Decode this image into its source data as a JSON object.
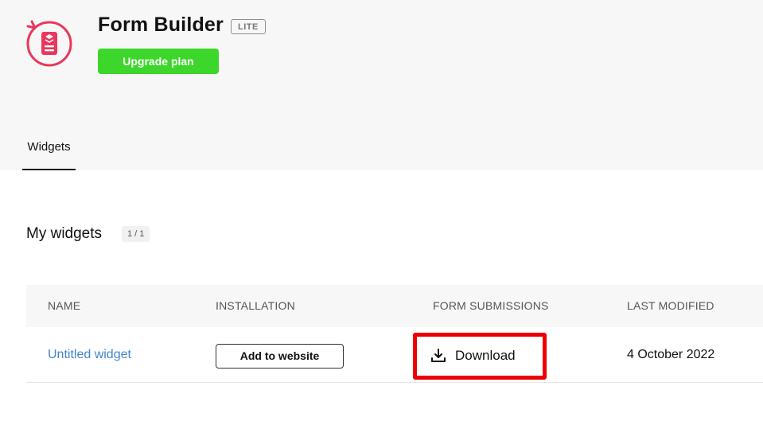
{
  "app": {
    "title": "Form Builder",
    "plan_badge": "LITE",
    "upgrade_label": "Upgrade plan",
    "logo_icon": "form-builder-logo-icon",
    "accent_color": "#e8385d",
    "upgrade_color": "#3dd62b"
  },
  "tabs": [
    {
      "label": "Widgets",
      "active": true
    }
  ],
  "section": {
    "title": "My widgets",
    "count": "1 / 1"
  },
  "table": {
    "columns": [
      "NAME",
      "INSTALLATION",
      "FORM SUBMISSIONS",
      "LAST MODIFIED"
    ],
    "rows": [
      {
        "name": "Untitled widget",
        "installation_label": "Add to website",
        "submissions_label": "Download",
        "submissions_icon": "download-icon",
        "last_modified": "4 October 2022"
      }
    ]
  },
  "highlight_color": "#ee0000"
}
